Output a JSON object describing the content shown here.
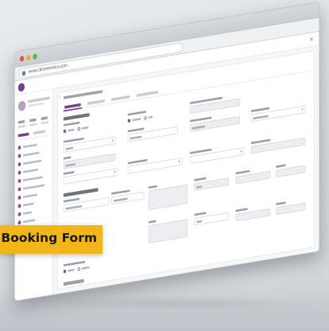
{
  "browser": {
    "url": "www.cdcentimeira.com"
  },
  "app": {
    "logo_label": "",
    "close_icon": "close-icon",
    "sidebar": {
      "user_name": "",
      "stats": [
        {
          "value": "",
          "label": ""
        },
        {
          "value": "",
          "label": ""
        },
        {
          "value": "",
          "label": ""
        }
      ],
      "tabs": [
        "",
        ""
      ],
      "nav_items": [
        "",
        "",
        "",
        "",
        "",
        "",
        "",
        "",
        "",
        "",
        "",
        "",
        ""
      ]
    },
    "page_title": "",
    "tabs": [
      "",
      "",
      "",
      ""
    ],
    "sections": [
      "",
      ""
    ]
  },
  "banner": {
    "label": "Booking Form",
    "color": "#f2b51a"
  }
}
